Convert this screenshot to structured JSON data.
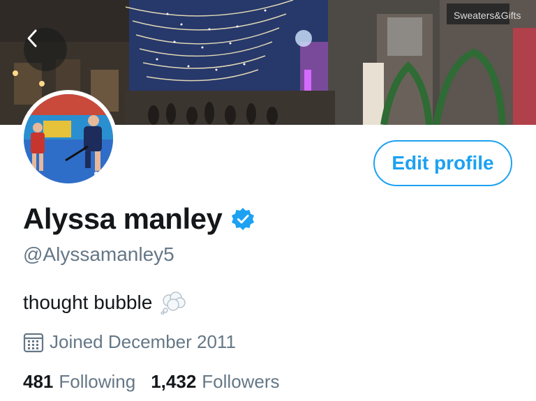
{
  "banner": {
    "shop_sign": "Sweaters&Gifts"
  },
  "profile": {
    "display_name": "Alyssa manley",
    "handle": "@Alyssamanley5",
    "bio": "thought bubble",
    "joined": "Joined December 2011",
    "edit_label": "Edit profile"
  },
  "stats": {
    "following_count": "481",
    "following_label": "Following",
    "followers_count": "1,432",
    "followers_label": "Followers"
  },
  "colors": {
    "accent": "#1da1f2",
    "secondary_text": "#657786",
    "primary_text": "#14171a"
  }
}
